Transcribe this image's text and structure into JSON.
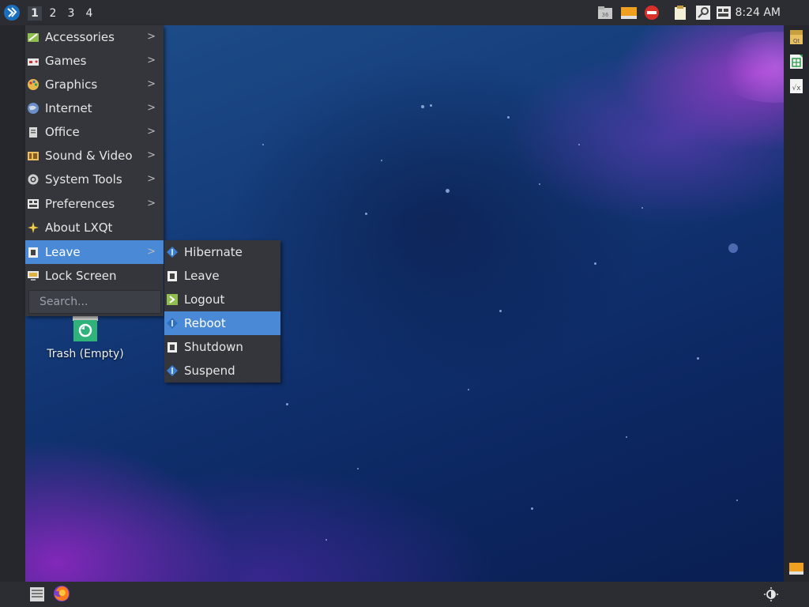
{
  "top_panel": {
    "workspaces": [
      "1",
      "2",
      "3",
      "4"
    ],
    "active_workspace": "1",
    "clock": "8:24 AM",
    "tray_icons": [
      "file-manager-icon",
      "drive-icon",
      "stop-icon",
      "clipboard-icon",
      "search-tool-icon",
      "keyboard-icon"
    ]
  },
  "main_menu": {
    "items": [
      {
        "label": "Accessories",
        "icon": "accessories-icon",
        "submenu": true
      },
      {
        "label": "Games",
        "icon": "games-icon",
        "submenu": true
      },
      {
        "label": "Graphics",
        "icon": "graphics-icon",
        "submenu": true
      },
      {
        "label": "Internet",
        "icon": "internet-icon",
        "submenu": true
      },
      {
        "label": "Office",
        "icon": "office-icon",
        "submenu": true
      },
      {
        "label": "Sound & Video",
        "icon": "sound-video-icon",
        "submenu": true
      },
      {
        "label": "System Tools",
        "icon": "system-tools-icon",
        "submenu": true
      },
      {
        "label": "Preferences",
        "icon": "preferences-icon",
        "submenu": true
      },
      {
        "label": "About LXQt",
        "icon": "about-icon",
        "submenu": false
      },
      {
        "label": "Leave",
        "icon": "leave-icon",
        "submenu": true,
        "selected": true
      },
      {
        "label": "Lock Screen",
        "icon": "lock-screen-icon",
        "submenu": false
      }
    ],
    "search_placeholder": "Search..."
  },
  "leave_submenu": {
    "items": [
      {
        "label": "Hibernate",
        "icon": "hibernate-icon"
      },
      {
        "label": "Leave",
        "icon": "leave-icon"
      },
      {
        "label": "Logout",
        "icon": "logout-icon"
      },
      {
        "label": "Reboot",
        "icon": "reboot-icon",
        "selected": true
      },
      {
        "label": "Shutdown",
        "icon": "shutdown-icon"
      },
      {
        "label": "Suspend",
        "icon": "suspend-icon"
      }
    ]
  },
  "desktop": {
    "trash_label": "Trash (Empty)"
  },
  "right_dock": {
    "icons": [
      "qt-designer-icon",
      "spreadsheet-icon",
      "formula-icon",
      "drive-icon"
    ]
  },
  "bottom_panel": {
    "icons": [
      "show-desktop-icon",
      "firefox-icon",
      "brightness-icon"
    ]
  },
  "colors": {
    "panel": "#2b2d33",
    "menu_bg": "#34363c",
    "highlight": "#4a89d6"
  }
}
